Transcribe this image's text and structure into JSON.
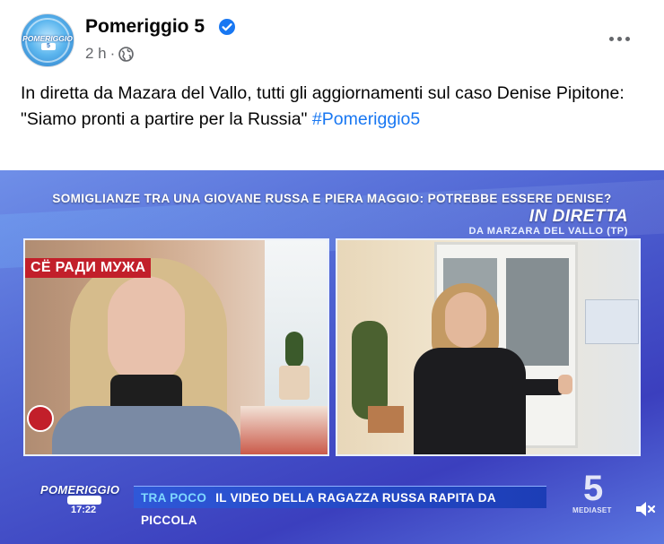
{
  "post": {
    "page_name": "Pomeriggio 5",
    "time": "2 h",
    "separator": "·",
    "text_line1": "In diretta da Mazara del Vallo, tutti gli aggiornamenti sul caso Denise Pipitone:",
    "text_line2": "\"Siamo pronti a partire per la Russia\"",
    "hashtag": "#Pomeriggio5",
    "avatar_text": "POMERIGGIO",
    "avatar_num": "5"
  },
  "video": {
    "headline": "SOMIGLIANZE TRA UNA GIOVANE RUSSA E PIERA MAGGIO: POTREBBE ESSERE DENISE?",
    "live_label": "IN DIRETTA",
    "live_location": "DA MARZARA DEL VALLO (TP)",
    "russian_caption": "СЁ РАДИ МУЖА",
    "show_name": "POMERIGGIO",
    "show_time": "17:22",
    "ticker_soon": "TRA POCO",
    "ticker_text": "IL VIDEO DELLA RAGAZZA RUSSA RAPITA DA PICCOLA",
    "channel_number": "5",
    "channel_name": "MEDIASET"
  },
  "colors": {
    "link": "#1877f2",
    "verified": "#1877f2",
    "secondary_text": "#65676b"
  },
  "icons": [
    "verified-badge-icon",
    "globe-icon",
    "more-options-icon",
    "volume-muted-icon"
  ]
}
